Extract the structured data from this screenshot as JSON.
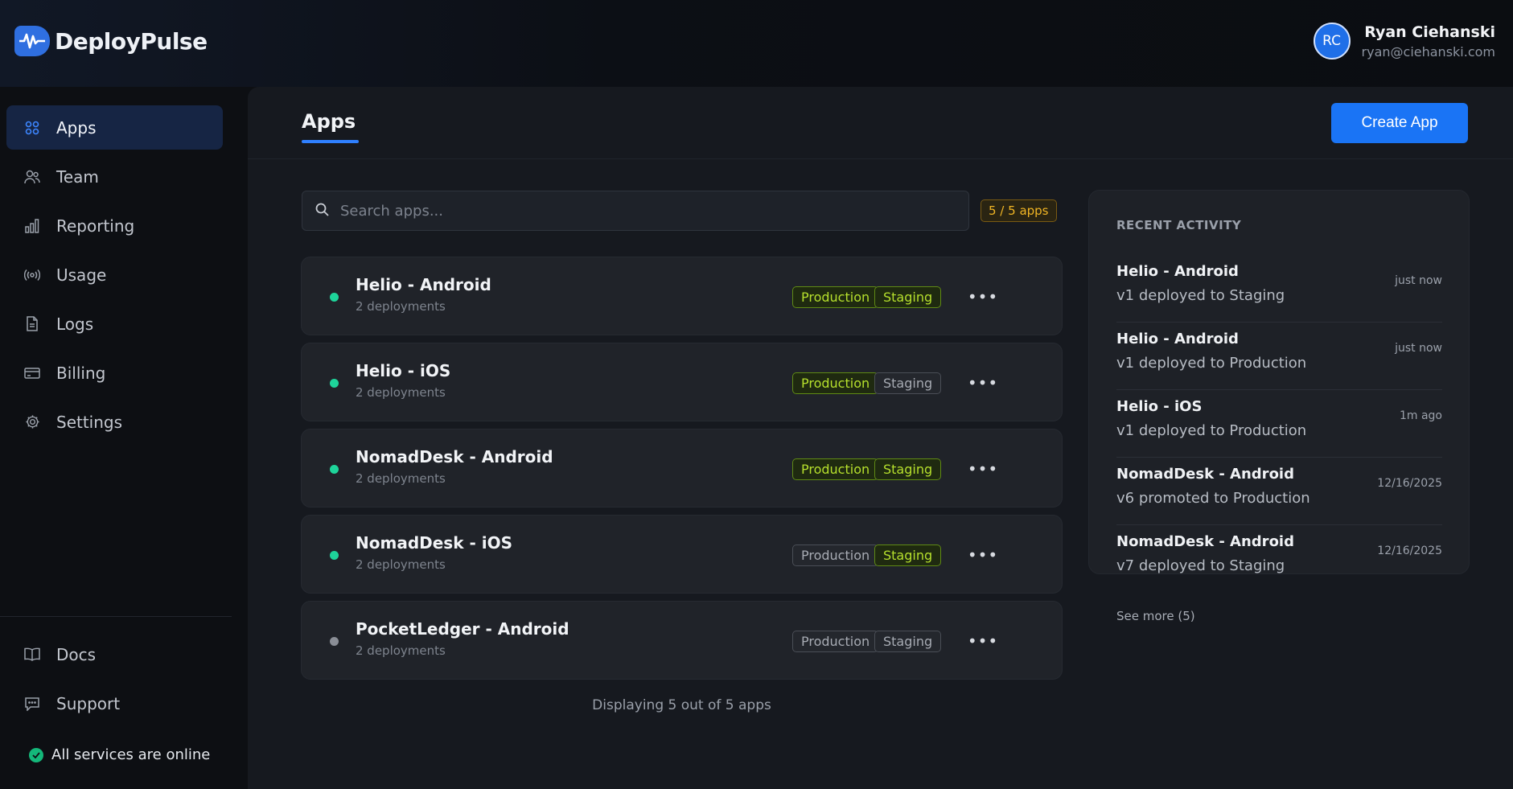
{
  "brand": {
    "name": "DeployPulse"
  },
  "user": {
    "initials": "RC",
    "name": "Ryan Ciehanski",
    "email": "ryan@ciehanski.com"
  },
  "sidebar": {
    "items": [
      {
        "label": "Apps",
        "icon": "grid-icon",
        "active": true
      },
      {
        "label": "Team",
        "icon": "users-icon"
      },
      {
        "label": "Reporting",
        "icon": "bar-chart-icon"
      },
      {
        "label": "Usage",
        "icon": "broadcast-icon"
      },
      {
        "label": "Logs",
        "icon": "file-icon"
      },
      {
        "label": "Billing",
        "icon": "credit-card-icon"
      },
      {
        "label": "Settings",
        "icon": "gear-icon"
      }
    ],
    "bottom_items": [
      {
        "label": "Docs",
        "icon": "book-icon"
      },
      {
        "label": "Support",
        "icon": "chat-icon"
      }
    ],
    "status": "All services are online"
  },
  "main": {
    "title": "Apps",
    "create_button": "Create App",
    "search_placeholder": "Search apps...",
    "count_badge": "5 / 5 apps",
    "footer": "Displaying 5 out of 5 apps",
    "apps": [
      {
        "name": "Helio - Android",
        "sub": "2 deployments",
        "online": true,
        "production": "Production",
        "staging": "Staging",
        "production_active": true,
        "staging_active": true
      },
      {
        "name": "Helio - iOS",
        "sub": "2 deployments",
        "online": true,
        "production": "Production",
        "staging": "Staging",
        "production_active": true,
        "staging_active": false
      },
      {
        "name": "NomadDesk - Android",
        "sub": "2 deployments",
        "online": true,
        "production": "Production",
        "staging": "Staging",
        "production_active": true,
        "staging_active": true
      },
      {
        "name": "NomadDesk - iOS",
        "sub": "2 deployments",
        "online": true,
        "production": "Production",
        "staging": "Staging",
        "production_active": false,
        "staging_active": true
      },
      {
        "name": "PocketLedger - Android",
        "sub": "2 deployments",
        "online": false,
        "production": "Production",
        "staging": "Staging",
        "production_active": false,
        "staging_active": false
      }
    ]
  },
  "activity": {
    "heading": "RECENT ACTIVITY",
    "items": [
      {
        "title": "Helio - Android",
        "desc": "v1 deployed to Staging",
        "time": "just now"
      },
      {
        "title": "Helio - Android",
        "desc": "v1 deployed to Production",
        "time": "just now"
      },
      {
        "title": "Helio - iOS",
        "desc": "v1 deployed to Production",
        "time": "1m ago"
      },
      {
        "title": "NomadDesk - Android",
        "desc": "v6 promoted to Production",
        "time": "12/16/2025"
      },
      {
        "title": "NomadDesk - Android",
        "desc": "v7 deployed to Staging",
        "time": "12/16/2025"
      }
    ],
    "see_more": "See more (5)"
  },
  "colors": {
    "accent": "#1a74f5",
    "online": "#1ed49a",
    "env_on": "#b6e02d",
    "badge": "#f1b524"
  }
}
